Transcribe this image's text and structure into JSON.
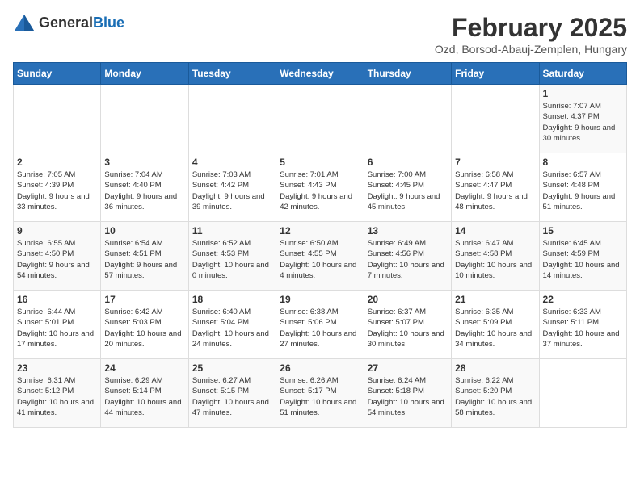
{
  "logo": {
    "general": "General",
    "blue": "Blue"
  },
  "title": "February 2025",
  "subtitle": "Ozd, Borsod-Abauj-Zemplen, Hungary",
  "days_of_week": [
    "Sunday",
    "Monday",
    "Tuesday",
    "Wednesday",
    "Thursday",
    "Friday",
    "Saturday"
  ],
  "weeks": [
    [
      {
        "day": "",
        "info": ""
      },
      {
        "day": "",
        "info": ""
      },
      {
        "day": "",
        "info": ""
      },
      {
        "day": "",
        "info": ""
      },
      {
        "day": "",
        "info": ""
      },
      {
        "day": "",
        "info": ""
      },
      {
        "day": "1",
        "info": "Sunrise: 7:07 AM\nSunset: 4:37 PM\nDaylight: 9 hours and 30 minutes."
      }
    ],
    [
      {
        "day": "2",
        "info": "Sunrise: 7:05 AM\nSunset: 4:39 PM\nDaylight: 9 hours and 33 minutes."
      },
      {
        "day": "3",
        "info": "Sunrise: 7:04 AM\nSunset: 4:40 PM\nDaylight: 9 hours and 36 minutes."
      },
      {
        "day": "4",
        "info": "Sunrise: 7:03 AM\nSunset: 4:42 PM\nDaylight: 9 hours and 39 minutes."
      },
      {
        "day": "5",
        "info": "Sunrise: 7:01 AM\nSunset: 4:43 PM\nDaylight: 9 hours and 42 minutes."
      },
      {
        "day": "6",
        "info": "Sunrise: 7:00 AM\nSunset: 4:45 PM\nDaylight: 9 hours and 45 minutes."
      },
      {
        "day": "7",
        "info": "Sunrise: 6:58 AM\nSunset: 4:47 PM\nDaylight: 9 hours and 48 minutes."
      },
      {
        "day": "8",
        "info": "Sunrise: 6:57 AM\nSunset: 4:48 PM\nDaylight: 9 hours and 51 minutes."
      }
    ],
    [
      {
        "day": "9",
        "info": "Sunrise: 6:55 AM\nSunset: 4:50 PM\nDaylight: 9 hours and 54 minutes."
      },
      {
        "day": "10",
        "info": "Sunrise: 6:54 AM\nSunset: 4:51 PM\nDaylight: 9 hours and 57 minutes."
      },
      {
        "day": "11",
        "info": "Sunrise: 6:52 AM\nSunset: 4:53 PM\nDaylight: 10 hours and 0 minutes."
      },
      {
        "day": "12",
        "info": "Sunrise: 6:50 AM\nSunset: 4:55 PM\nDaylight: 10 hours and 4 minutes."
      },
      {
        "day": "13",
        "info": "Sunrise: 6:49 AM\nSunset: 4:56 PM\nDaylight: 10 hours and 7 minutes."
      },
      {
        "day": "14",
        "info": "Sunrise: 6:47 AM\nSunset: 4:58 PM\nDaylight: 10 hours and 10 minutes."
      },
      {
        "day": "15",
        "info": "Sunrise: 6:45 AM\nSunset: 4:59 PM\nDaylight: 10 hours and 14 minutes."
      }
    ],
    [
      {
        "day": "16",
        "info": "Sunrise: 6:44 AM\nSunset: 5:01 PM\nDaylight: 10 hours and 17 minutes."
      },
      {
        "day": "17",
        "info": "Sunrise: 6:42 AM\nSunset: 5:03 PM\nDaylight: 10 hours and 20 minutes."
      },
      {
        "day": "18",
        "info": "Sunrise: 6:40 AM\nSunset: 5:04 PM\nDaylight: 10 hours and 24 minutes."
      },
      {
        "day": "19",
        "info": "Sunrise: 6:38 AM\nSunset: 5:06 PM\nDaylight: 10 hours and 27 minutes."
      },
      {
        "day": "20",
        "info": "Sunrise: 6:37 AM\nSunset: 5:07 PM\nDaylight: 10 hours and 30 minutes."
      },
      {
        "day": "21",
        "info": "Sunrise: 6:35 AM\nSunset: 5:09 PM\nDaylight: 10 hours and 34 minutes."
      },
      {
        "day": "22",
        "info": "Sunrise: 6:33 AM\nSunset: 5:11 PM\nDaylight: 10 hours and 37 minutes."
      }
    ],
    [
      {
        "day": "23",
        "info": "Sunrise: 6:31 AM\nSunset: 5:12 PM\nDaylight: 10 hours and 41 minutes."
      },
      {
        "day": "24",
        "info": "Sunrise: 6:29 AM\nSunset: 5:14 PM\nDaylight: 10 hours and 44 minutes."
      },
      {
        "day": "25",
        "info": "Sunrise: 6:27 AM\nSunset: 5:15 PM\nDaylight: 10 hours and 47 minutes."
      },
      {
        "day": "26",
        "info": "Sunrise: 6:26 AM\nSunset: 5:17 PM\nDaylight: 10 hours and 51 minutes."
      },
      {
        "day": "27",
        "info": "Sunrise: 6:24 AM\nSunset: 5:18 PM\nDaylight: 10 hours and 54 minutes."
      },
      {
        "day": "28",
        "info": "Sunrise: 6:22 AM\nSunset: 5:20 PM\nDaylight: 10 hours and 58 minutes."
      },
      {
        "day": "",
        "info": ""
      }
    ]
  ]
}
